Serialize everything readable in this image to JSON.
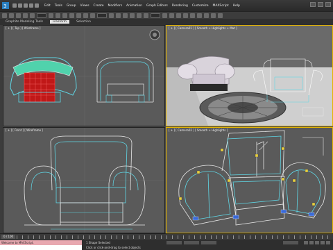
{
  "app": {
    "logo_icon": "3ds-max-logo-icon"
  },
  "menubar": {
    "items": [
      "Edit",
      "Tools",
      "Group",
      "Views",
      "Create",
      "Modifiers",
      "Animation",
      "Graph Editors",
      "Rendering",
      "Customize",
      "MAXScript",
      "Help"
    ]
  },
  "ribbon": {
    "tabs": [
      "Graphite Modeling Tools",
      "Freeform",
      "Selection"
    ],
    "active_tab": "Freeform"
  },
  "viewports": {
    "top_left": {
      "label": "[ + ] [ Top ] [ Wireframe ]"
    },
    "top_right": {
      "label": "[ + ] [ Camera01 ] [ Smooth + Highlights + Mat ]"
    },
    "bottom_left": {
      "label": "[ + ] [ Front ] [ Wireframe ]"
    },
    "bottom_right": {
      "label": "[ + ] [ Camera02 ] [ Smooth + Highlights ]"
    }
  },
  "timeline": {
    "frame": "0 / 100"
  },
  "status": {
    "script_line1": "Welcome to MAXScript.",
    "shape_text": "1 Shape Selected",
    "hint_text": "Click or click-and-drag to select objects"
  },
  "colors": {
    "accent_active_viewport": "#e4b400",
    "wire_cyan": "#5fd7e6",
    "wire_white": "#e8e8e8"
  }
}
